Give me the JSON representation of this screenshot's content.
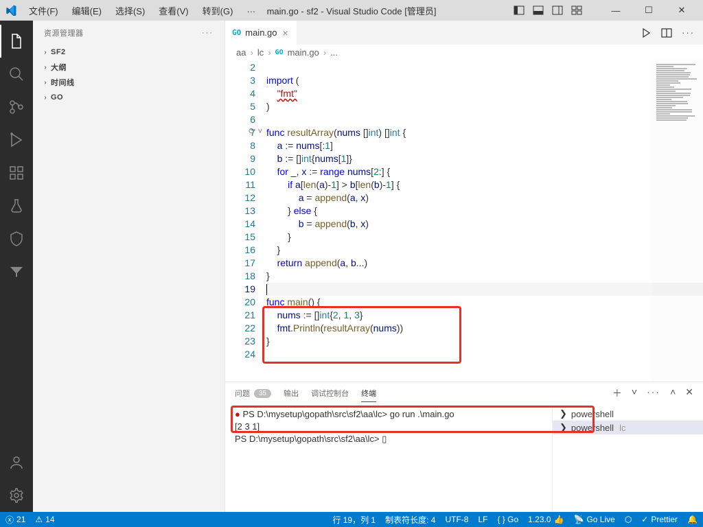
{
  "window": {
    "title": "main.go - sf2 - Visual Studio Code [管理员]"
  },
  "menu": {
    "file": "文件(F)",
    "edit": "编辑(E)",
    "select": "选择(S)",
    "view": "查看(V)",
    "goto": "转到(G)",
    "more": "…"
  },
  "sidebar": {
    "title": "资源管理器",
    "items": [
      {
        "label": "SF2"
      },
      {
        "label": "大纲"
      },
      {
        "label": "时间线"
      },
      {
        "label": "GO"
      }
    ]
  },
  "tabs": {
    "file_icon": "GO",
    "filename": "main.go"
  },
  "breadcrumbs": {
    "p0": "aa",
    "p1": "lc",
    "p2": "main.go",
    "p3": "..."
  },
  "code": {
    "lines": [
      {
        "n": 2,
        "html": ""
      },
      {
        "n": 3,
        "html": "<span class='kw'>import</span> ("
      },
      {
        "n": 4,
        "html": "    <span class='str underline-wavy'>\"fmt\"</span>"
      },
      {
        "n": 5,
        "html": ")"
      },
      {
        "n": 6,
        "html": ""
      },
      {
        "n": 7,
        "html": "<span class='kw'>func</span> <span class='fn'>resultArray</span>(<span class='ident'>nums</span> []<span class='ty'>int</span>) []<span class='ty'>int</span> {"
      },
      {
        "n": 8,
        "html": "    <span class='ident'>a</span> := <span class='ident'>nums</span>[:<span class='num'>1</span>]"
      },
      {
        "n": 9,
        "html": "    <span class='ident'>b</span> := []<span class='ty'>int</span>{<span class='ident'>nums</span>[<span class='num'>1</span>]}"
      },
      {
        "n": 10,
        "html": "    <span class='kw'>for</span> <span class='ident'>_</span>, <span class='ident'>x</span> := <span class='kw'>range</span> <span class='ident'>nums</span>[<span class='num'>2</span>:] {"
      },
      {
        "n": 11,
        "html": "        <span class='kw'>if</span> <span class='ident'>a</span>[<span class='fn'>len</span>(<span class='ident'>a</span>)-<span class='num'>1</span>] &gt; <span class='ident'>b</span>[<span class='fn'>len</span>(<span class='ident'>b</span>)-<span class='num'>1</span>] {"
      },
      {
        "n": 12,
        "html": "            <span class='ident'>a</span> = <span class='fn'>append</span>(<span class='ident'>a</span>, <span class='ident'>x</span>)"
      },
      {
        "n": 13,
        "html": "        } <span class='kw'>else</span> {"
      },
      {
        "n": 14,
        "html": "            <span class='ident'>b</span> = <span class='fn'>append</span>(<span class='ident'>b</span>, <span class='ident'>x</span>)"
      },
      {
        "n": 15,
        "html": "        }"
      },
      {
        "n": 16,
        "html": "    }"
      },
      {
        "n": 17,
        "html": "    <span class='kw'>return</span> <span class='fn'>append</span>(<span class='ident'>a</span>, <span class='ident'>b</span>...)"
      },
      {
        "n": 18,
        "html": "}"
      },
      {
        "n": 19,
        "html": "<span class='cursor'></span>",
        "current": true
      },
      {
        "n": 20,
        "html": "<span class='kw'>func</span> <span class='fn'>main</span>() {"
      },
      {
        "n": 21,
        "html": "    <span class='ident'>nums</span> := []<span class='ty'>int</span>{<span class='num'>2</span>, <span class='num'>1</span>, <span class='num'>3</span>}"
      },
      {
        "n": 22,
        "html": "    <span class='ident'>fmt</span>.<span class='fn'>Println</span>(<span class='fn'>resultArray</span>(<span class='ident'>nums</span>))"
      },
      {
        "n": 23,
        "html": "}"
      },
      {
        "n": 24,
        "html": ""
      }
    ]
  },
  "panel": {
    "tabs": {
      "problems": "问题",
      "problems_count": "35",
      "output": "输出",
      "debug": "调试控制台",
      "terminal": "终端"
    },
    "terminal_lines": [
      "PS D:\\mysetup\\gopath\\src\\sf2\\aa\\lc> go run .\\main.go",
      "[2 3 1]",
      "PS D:\\mysetup\\gopath\\src\\sf2\\aa\\lc> ▯"
    ],
    "sessions": [
      {
        "name": "powershell",
        "extra": ""
      },
      {
        "name": "powershell",
        "extra": "lc"
      }
    ]
  },
  "status": {
    "errors": "21",
    "warnings": "14",
    "ln_col": "行 19，列 1",
    "tab_size": "制表符长度: 4",
    "encoding": "UTF-8",
    "eol": "LF",
    "lang": "{ }  Go",
    "go_ver": "1.23.0",
    "go_live": "Go Live",
    "prettier": "Prettier",
    "notif": ""
  }
}
